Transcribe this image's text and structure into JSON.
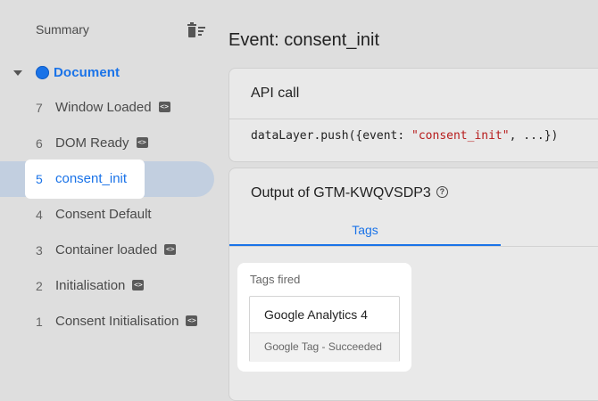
{
  "sidebar": {
    "summary_label": "Summary",
    "document_label": "Document",
    "events": [
      {
        "num": "7",
        "label": "Window Loaded",
        "code": true
      },
      {
        "num": "6",
        "label": "DOM Ready",
        "code": true
      },
      {
        "num": "5",
        "label": "consent_init",
        "code": false,
        "selected": true
      },
      {
        "num": "4",
        "label": "Consent Default",
        "code": false
      },
      {
        "num": "3",
        "label": "Container loaded",
        "code": true
      },
      {
        "num": "2",
        "label": "Initialisation",
        "code": true
      },
      {
        "num": "1",
        "label": "Consent Initialisation",
        "code": true
      }
    ]
  },
  "main": {
    "title": "Event: consent_init",
    "api_card": {
      "header": "API call",
      "code_prefix": "dataLayer.push({event: ",
      "code_string": "\"consent_init\"",
      "code_suffix": ", ...})"
    },
    "output_card": {
      "header": "Output of GTM-KWQVSDP3",
      "tab_label": "Tags",
      "tags_fired_label": "Tags fired",
      "tag": {
        "name": "Google Analytics 4",
        "status": "Google Tag - Succeeded"
      }
    }
  },
  "colors": {
    "accent": "#1a73e8",
    "selected_bg": "#c2cfe0",
    "string": "#b71c1c"
  },
  "icons": {
    "trash": "delete-sweep-icon",
    "help": "help-circle-icon",
    "code": "code-icon"
  }
}
